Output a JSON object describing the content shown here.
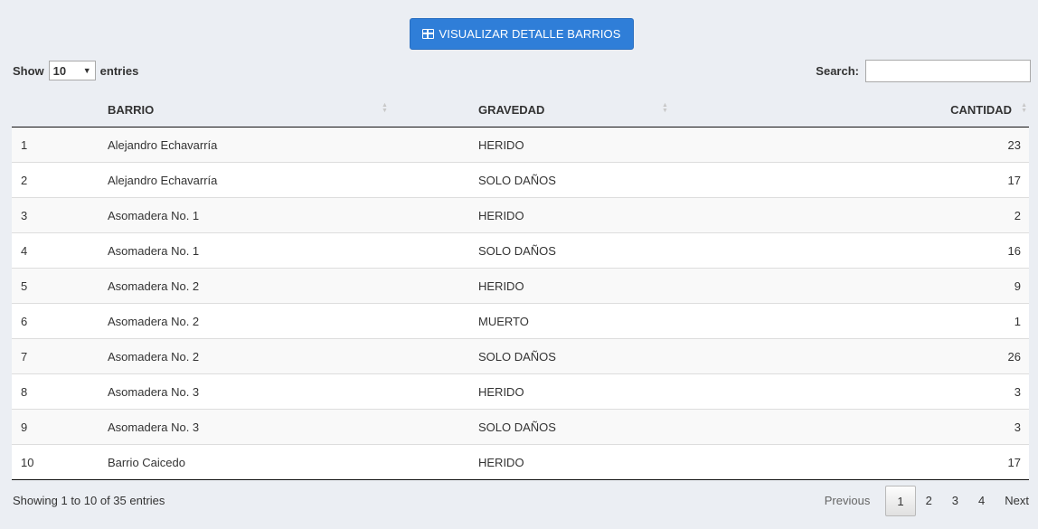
{
  "toolbar": {
    "visualize_label": "VISUALIZAR DETALLE BARRIOS"
  },
  "length": {
    "show": "Show",
    "value": "10",
    "entries": "entries"
  },
  "search": {
    "label": "Search:",
    "value": ""
  },
  "table": {
    "headers": [
      "",
      "BARRIO",
      "GRAVEDAD",
      "CANTIDAD"
    ],
    "rows": [
      [
        "1",
        "Alejandro Echavarría",
        "HERIDO",
        "23"
      ],
      [
        "2",
        "Alejandro Echavarría",
        "SOLO DAÑOS",
        "17"
      ],
      [
        "3",
        "Asomadera No. 1",
        "HERIDO",
        "2"
      ],
      [
        "4",
        "Asomadera No. 1",
        "SOLO DAÑOS",
        "16"
      ],
      [
        "5",
        "Asomadera No. 2",
        "HERIDO",
        "9"
      ],
      [
        "6",
        "Asomadera No. 2",
        "MUERTO",
        "1"
      ],
      [
        "7",
        "Asomadera No. 2",
        "SOLO DAÑOS",
        "26"
      ],
      [
        "8",
        "Asomadera No. 3",
        "HERIDO",
        "3"
      ],
      [
        "9",
        "Asomadera No. 3",
        "SOLO DAÑOS",
        "3"
      ],
      [
        "10",
        "Barrio Caicedo",
        "HERIDO",
        "17"
      ]
    ]
  },
  "info": "Showing 1 to 10 of 35 entries",
  "pagination": {
    "previous": "Previous",
    "pages": [
      "1",
      "2",
      "3",
      "4"
    ],
    "current": "1",
    "next": "Next"
  }
}
